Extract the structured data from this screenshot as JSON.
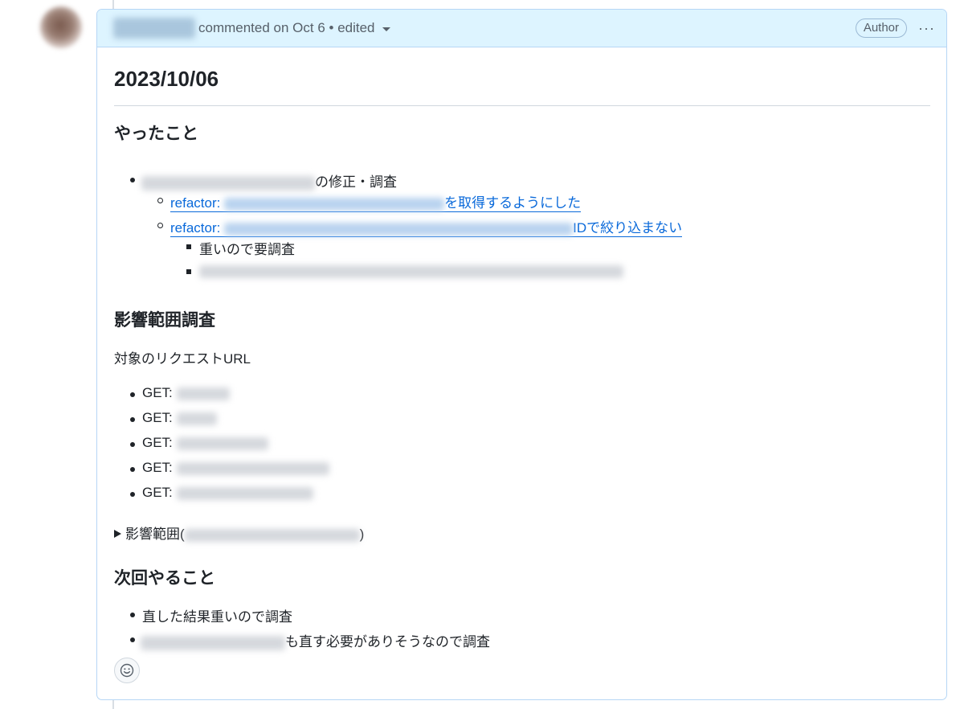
{
  "header": {
    "action_text": "commented on Oct 6 • edited",
    "author_badge": "Author",
    "more_label": "···"
  },
  "content": {
    "date_heading": "2023/10/06",
    "section1": {
      "heading": "やったこと",
      "item1_suffix": "の修正・調査",
      "link1_prefix": "refactor:",
      "link1_suffix": "を取得するようにした",
      "link2_prefix": "refactor:",
      "link2_suffix": "IDで絞り込まない",
      "sub_item1": "重いので要調査"
    },
    "section2": {
      "heading": "影響範囲調査",
      "intro": "対象のリクエストURL",
      "get_items": [
        "GET:",
        "GET:",
        "GET:",
        "GET:",
        "GET:"
      ],
      "details_prefix": "影響範囲(",
      "details_suffix": ")"
    },
    "section3": {
      "heading": "次回やること",
      "item1": "直した結果重いので調査",
      "item2_suffix": "も直す必要がありそうなので調査"
    }
  },
  "icons": {
    "reaction": "smiley-icon",
    "details": "triangle-right-icon",
    "dropdown": "caret-down-icon"
  }
}
